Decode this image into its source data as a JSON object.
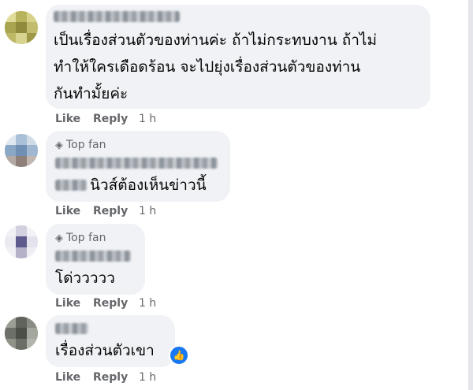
{
  "comments": [
    {
      "badge": "",
      "text_lines": [
        "เป็นเรื่องส่วนตัวของท่านค่ะ ถ้าไม่กระทบงาน ถ้าไม่",
        "ทำให้ใครเดือดร้อน จะไปยุ่งเรื่องส่วนตัวของท่าน",
        "กันทำมั้ยค่ะ"
      ],
      "like": "Like",
      "reply": "Reply",
      "time": "1 h"
    },
    {
      "badge": "Top fan",
      "text_lines": [
        "นิวส์ต้องเห็นข่าวนี้"
      ],
      "like": "Like",
      "reply": "Reply",
      "time": "1 h"
    },
    {
      "badge": "Top fan",
      "text_lines": [
        "โด่ววววว"
      ],
      "like": "Like",
      "reply": "Reply",
      "time": "1 h"
    },
    {
      "badge": "",
      "text_lines": [
        "เรื่องส่วนตัวเขา"
      ],
      "like": "Like",
      "reply": "Reply",
      "time": "1 h",
      "reaction": "like-reaction"
    }
  ],
  "colors": {
    "bubble": "#f0f2f5",
    "meta": "#65676b",
    "text": "#050505",
    "like_blue": "#1877f2"
  }
}
